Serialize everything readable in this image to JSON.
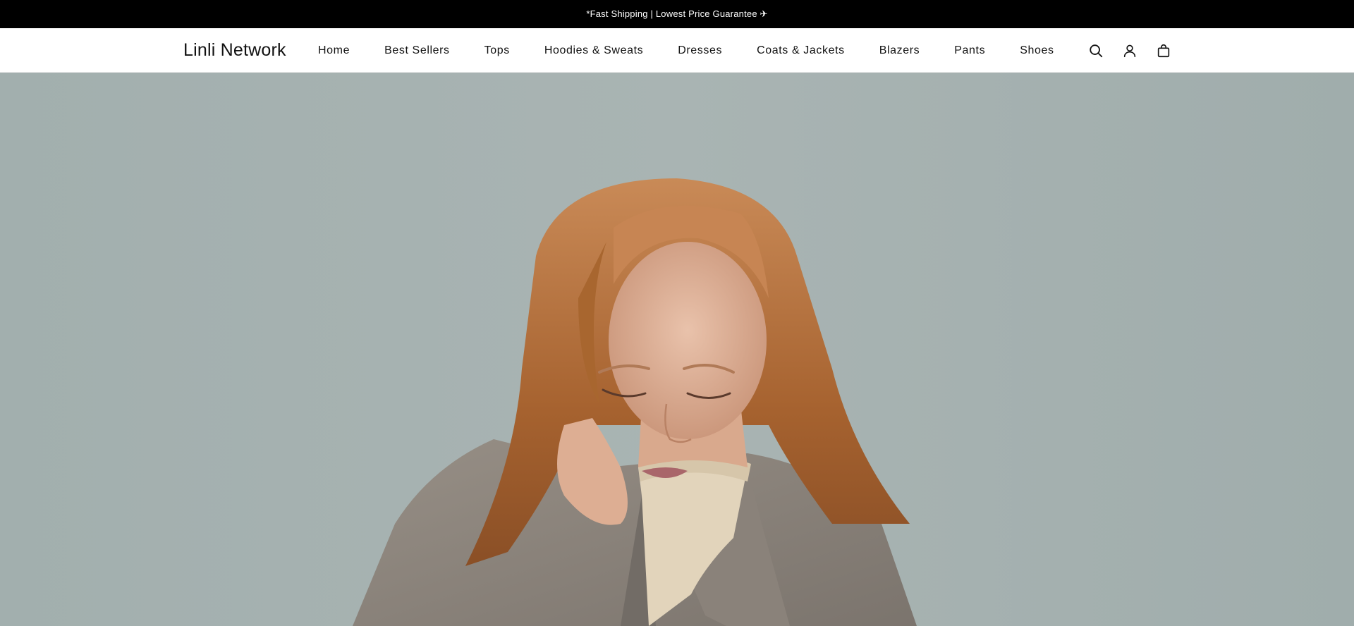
{
  "announcement": {
    "text": "*Fast Shipping | Lowest Price Guarantee ✈"
  },
  "header": {
    "logo": "Linli Network",
    "nav": [
      {
        "label": "Home"
      },
      {
        "label": "Best Sellers"
      },
      {
        "label": "Tops"
      },
      {
        "label": "Hoodies & Sweats"
      },
      {
        "label": "Dresses"
      },
      {
        "label": "Coats & Jackets"
      },
      {
        "label": "Blazers"
      },
      {
        "label": "Pants"
      },
      {
        "label": "Shoes"
      }
    ],
    "icons": [
      "search-icon",
      "account-icon",
      "cart-icon"
    ]
  },
  "hero": {
    "description_icon": "hero-image",
    "colors": {
      "background": "#a6b2b2",
      "hair": "#b8733f",
      "skin": "#e4b79f",
      "coat": "#8c847c",
      "sweater": "#e4d6bd"
    }
  }
}
